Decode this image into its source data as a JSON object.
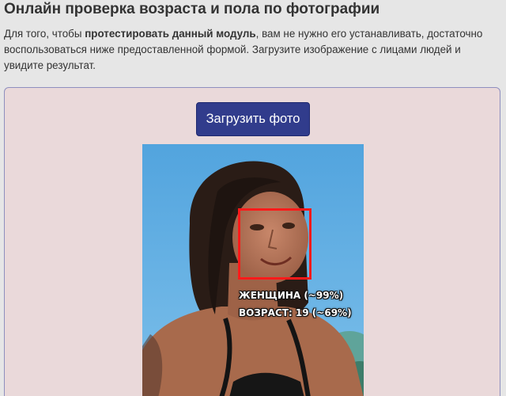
{
  "page": {
    "title": "Онлайн проверка возраста и пола по фотографии",
    "intro": {
      "part1": "Для того, чтобы ",
      "bold": "протестировать данный модуль",
      "part2": ", вам не нужно его устанавливать, достаточно воспользоваться ниже предоставленной формой. Загрузите изображение с лицами людей и увидите результат."
    }
  },
  "form": {
    "upload_label": "Загрузить фото"
  },
  "result": {
    "gender_label": "ЖЕНЩИНА (~99%)",
    "age_label": "ВОЗРАСТ: 19 (~69%)"
  },
  "colors": {
    "accent": "#313c8c",
    "face_box": "#ff1a1a",
    "panel_bg": "#ead9da",
    "page_bg": "#e6e6e6"
  }
}
